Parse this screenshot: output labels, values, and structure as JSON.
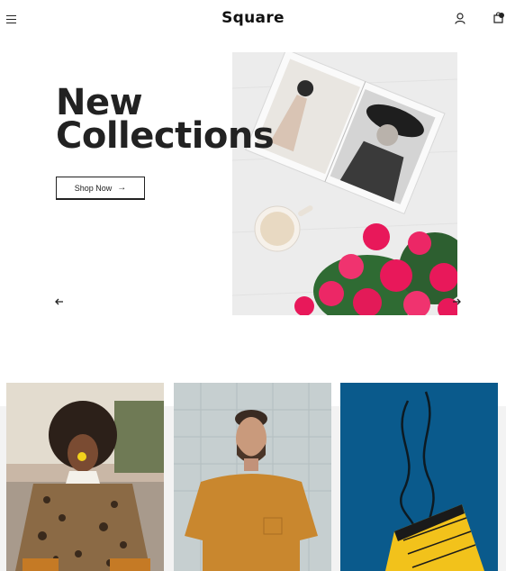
{
  "header": {
    "brand": "Square",
    "icons": [
      "menu-icon",
      "user-icon",
      "cart-icon"
    ]
  },
  "hero": {
    "title": "New\nCollections",
    "button_label": "Shop Now",
    "image": "magazine-coffee-flowers-photo"
  },
  "products": [
    {
      "image": "woman-leopard-coat-photo"
    },
    {
      "image": "man-mustard-tshirt-photo"
    },
    {
      "image": "yellow-boot-blue-background-photo"
    }
  ],
  "colors": {
    "text": "#222222",
    "flower_pink": "#e8185a",
    "boot_bg": "#0a5a8c",
    "boot_yellow": "#f2c21b",
    "tshirt": "#c9872e"
  }
}
